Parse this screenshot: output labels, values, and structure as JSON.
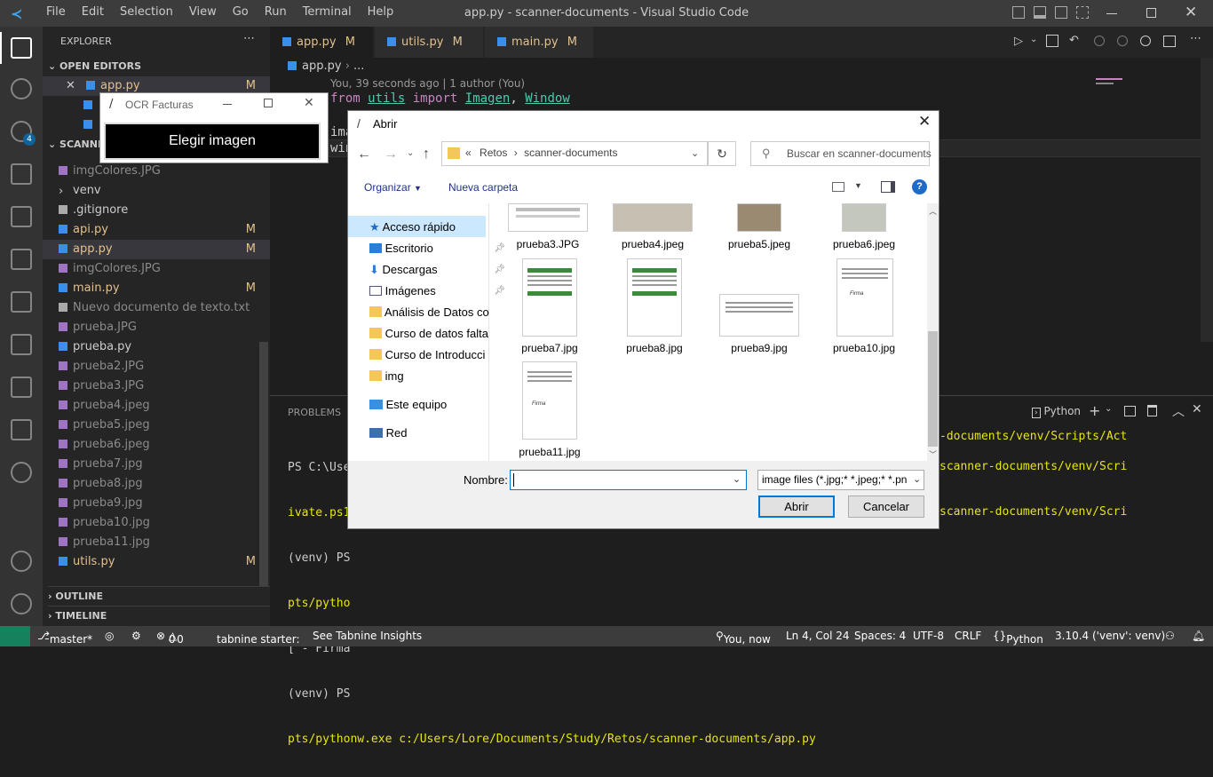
{
  "titlebar": {
    "menu": [
      "File",
      "Edit",
      "Selection",
      "View",
      "Go",
      "Run",
      "Terminal",
      "Help"
    ],
    "title": "app.py - scanner-documents - Visual Studio Code"
  },
  "activity": {
    "scm_badge": "4"
  },
  "sidebar": {
    "header": "EXPLORER",
    "open_editors_label": "OPEN EDITORS",
    "open_editor_1": "app.py",
    "open_editor_1_mark": "M",
    "project_label": "SCANNE",
    "files": [
      {
        "name": "imgColores.JPG",
        "mark": ""
      },
      {
        "name": "venv",
        "mark": ""
      },
      {
        "name": ".gitignore",
        "mark": ""
      },
      {
        "name": "api.py",
        "mark": "M"
      },
      {
        "name": "app.py",
        "mark": "M"
      },
      {
        "name": "imgColores.JPG",
        "mark": ""
      },
      {
        "name": "main.py",
        "mark": "M"
      },
      {
        "name": "Nuevo documento de texto.txt",
        "mark": ""
      },
      {
        "name": "prueba.JPG",
        "mark": ""
      },
      {
        "name": "prueba.py",
        "mark": ""
      },
      {
        "name": "prueba2.JPG",
        "mark": ""
      },
      {
        "name": "prueba3.JPG",
        "mark": ""
      },
      {
        "name": "prueba4.jpeg",
        "mark": ""
      },
      {
        "name": "prueba5.jpeg",
        "mark": ""
      },
      {
        "name": "prueba6.jpeg",
        "mark": ""
      },
      {
        "name": "prueba7.jpg",
        "mark": ""
      },
      {
        "name": "prueba8.jpg",
        "mark": ""
      },
      {
        "name": "prueba9.jpg",
        "mark": ""
      },
      {
        "name": "prueba10.jpg",
        "mark": ""
      },
      {
        "name": "prueba11.jpg",
        "mark": ""
      },
      {
        "name": "utils.py",
        "mark": "M"
      }
    ],
    "outline": "OUTLINE",
    "timeline": "TIMELINE"
  },
  "tabs": [
    {
      "name": "app.py",
      "mark": "M"
    },
    {
      "name": "utils.py",
      "mark": "M"
    },
    {
      "name": "main.py",
      "mark": "M"
    }
  ],
  "editor": {
    "breadcrumb": "app.py",
    "breadcrumb_more": "...",
    "blame": "You, 39 seconds ago | 1 author (You)",
    "line1_kw": "from",
    "line1_mod": "utils",
    "line1_imp": "import",
    "line1_a": "Imagen",
    "line1_b": "Window",
    "line3": "ima",
    "line4": "win"
  },
  "panel": {
    "tab": "PROBLEMS",
    "shell": "Python",
    "lines": [
      "PS C:\\User",
      "ivate.ps1",
      "(venv) PS",
      "pts/pytho",
      "['- Firma",
      "(venv) PS",
      "pts/pythonw.exe c:/Users/Lore/Documents/Study/Retos/scanner-documents/app.py"
    ],
    "right_lines": [
      "-documents/venv/Scripts/Act",
      "scanner-documents/venv/Scri",
      "scanner-documents/venv/Scri"
    ]
  },
  "status": {
    "branch": "master*",
    "problems": "0",
    "warnings": "0",
    "tabnine": "tabnine starter:",
    "insights": "See Tabnine Insights",
    "blame": "You, now",
    "position": "Ln 4, Col 24",
    "spaces": "Spaces: 4",
    "encoding": "UTF-8",
    "eol": "CRLF",
    "language": "Python",
    "interpreter": "3.10.4 ('venv': venv)"
  },
  "ocr": {
    "title": "OCR Facturas",
    "button": "Elegir imagen"
  },
  "dialog": {
    "title": "Abrir",
    "path_prefix": "«",
    "path1": "Retos",
    "path2": "scanner-documents",
    "search_placeholder": "Buscar en scanner-documents",
    "organize": "Organizar",
    "new_folder": "Nueva carpeta",
    "nav": [
      {
        "label": "Acceso rápido"
      },
      {
        "label": "Escritorio"
      },
      {
        "label": "Descargas"
      },
      {
        "label": "Imágenes"
      },
      {
        "label": "Análisis de Datos co"
      },
      {
        "label": "Curso de datos falta"
      },
      {
        "label": "Curso de Introducci"
      },
      {
        "label": "img"
      },
      {
        "label": "Este equipo"
      },
      {
        "label": "Red"
      }
    ],
    "files": [
      "prueba3.JPG",
      "prueba4.jpeg",
      "prueba5.jpeg",
      "prueba6.jpeg",
      "prueba7.jpg",
      "prueba8.jpg",
      "prueba9.jpg",
      "prueba10.jpg",
      "prueba11.jpg"
    ],
    "firma": "Firma",
    "filename_label": "Nombre:",
    "filename_value": "",
    "filter": "image files (*.jpg;* *.jpeg;* *.pn",
    "open": "Abrir",
    "cancel": "Cancelar"
  }
}
